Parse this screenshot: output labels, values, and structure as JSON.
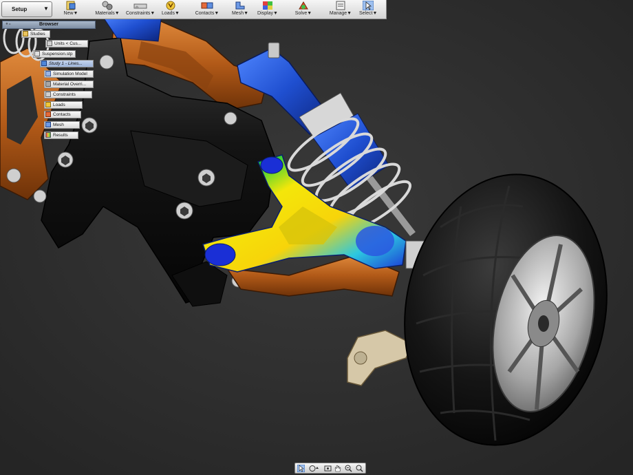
{
  "ribbon": {
    "setup_tab": "Setup",
    "buttons": [
      {
        "label": "New",
        "icon": "new-study-icon"
      },
      {
        "label": "Materials",
        "icon": "materials-icon"
      },
      {
        "label": "Constraints",
        "icon": "constraints-icon"
      },
      {
        "label": "Loads",
        "icon": "loads-icon"
      },
      {
        "label": "Contacts",
        "icon": "contacts-icon"
      },
      {
        "label": "Mesh",
        "icon": "mesh-icon"
      },
      {
        "label": "Display",
        "icon": "display-icon"
      },
      {
        "label": "Solve",
        "icon": "solve-icon"
      },
      {
        "label": "Manage",
        "icon": "manage-icon"
      },
      {
        "label": "Select",
        "icon": "select-cursor-icon"
      }
    ]
  },
  "browser": {
    "title": "Browser",
    "items": [
      {
        "label": "Studies"
      },
      {
        "label": "Units < Cus..."
      },
      {
        "label": "Suspension.stp"
      },
      {
        "label": "Study 1 - Lines..."
      },
      {
        "label": "Simulation Model"
      },
      {
        "label": "Material Overri..."
      },
      {
        "label": "Constraints"
      },
      {
        "label": "Loads"
      },
      {
        "label": "Contacts"
      },
      {
        "label": "Mesh"
      },
      {
        "label": "Results"
      }
    ]
  },
  "navbar": {
    "tools": [
      "select-icon",
      "pan-orbit-icon",
      "fit-view-icon",
      "pan-hand-icon",
      "zoom-window-icon",
      "zoom-icon"
    ]
  },
  "colors": {
    "background": "#2f2f2f",
    "frame_orange": "#b8621f",
    "shock_blue": "#1f4fd0",
    "chassis_black": "#121212",
    "tire_black": "#0d0d0d",
    "stress_low": "#1a2fd6",
    "stress_mid": "#22d03a",
    "stress_high": "#f4e60a"
  }
}
